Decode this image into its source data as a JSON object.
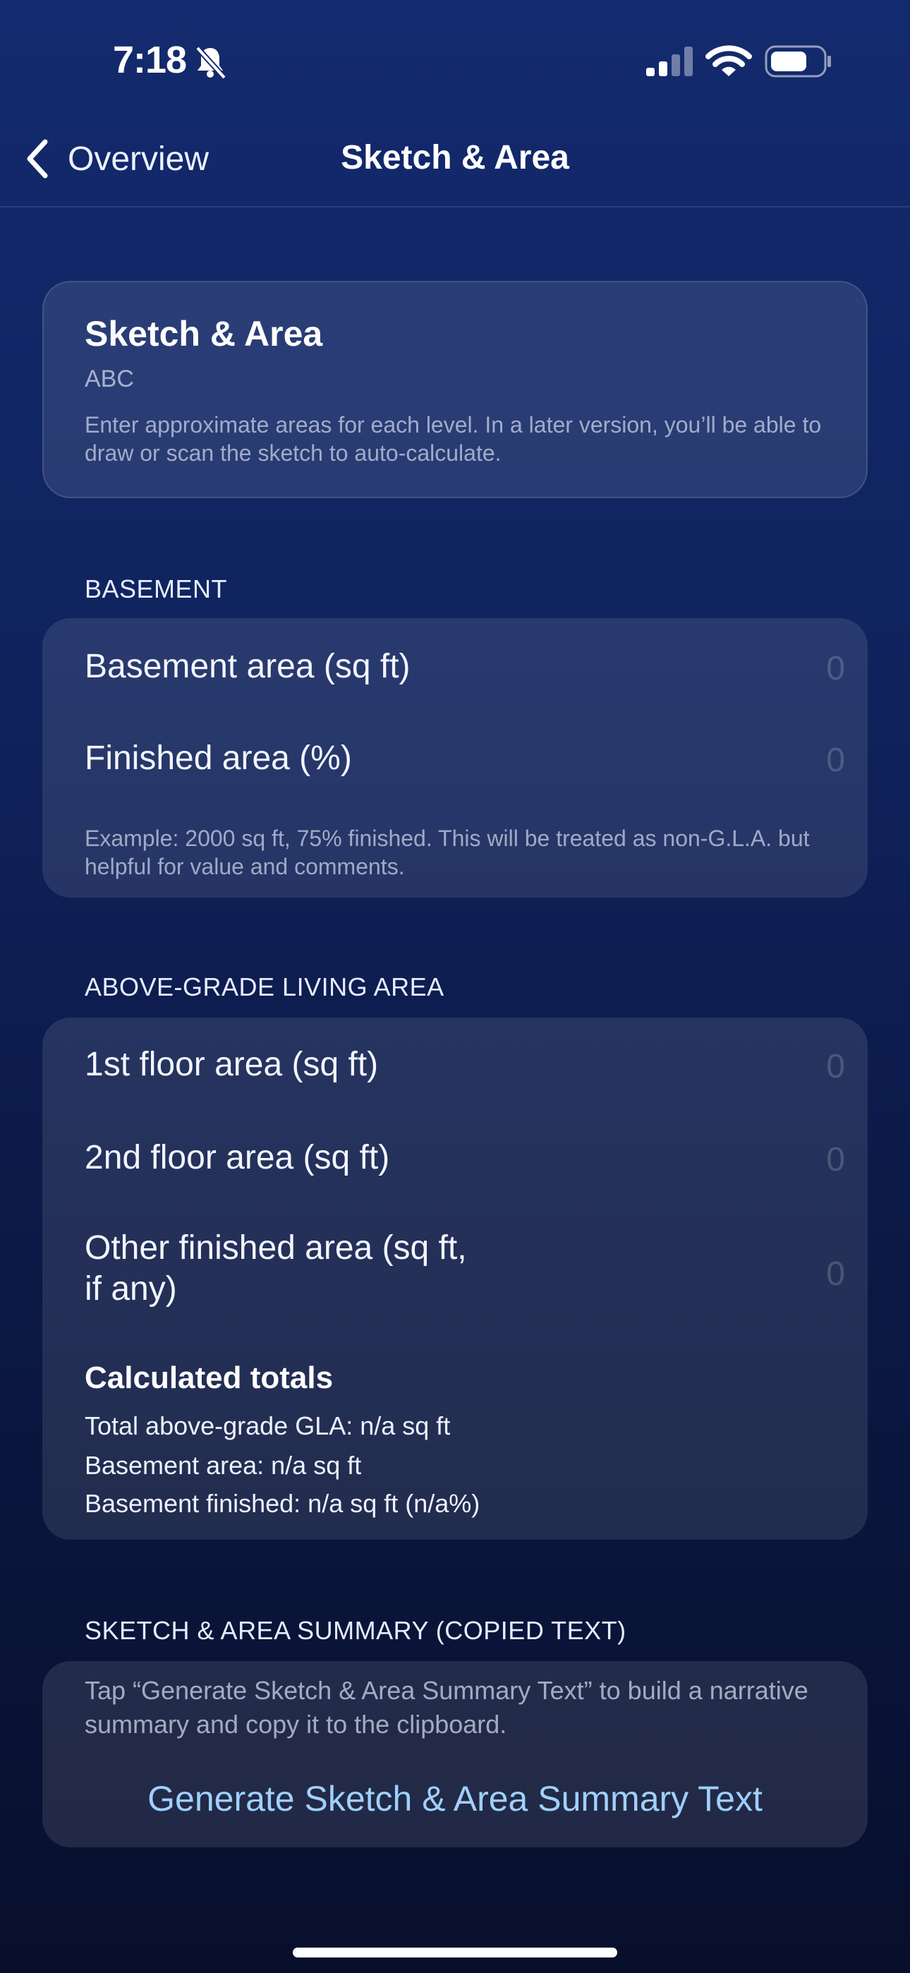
{
  "status_bar": {
    "time": "7:18",
    "icons": [
      "bell-slash-icon",
      "signal-icon",
      "wifi-icon",
      "battery-icon"
    ]
  },
  "nav": {
    "back_label": "Overview",
    "title": "Sketch & Area"
  },
  "intro": {
    "title": "Sketch & Area",
    "subtitle": "ABC",
    "description": "Enter approximate areas for each level. In a later version, you’ll be able to draw or scan the sketch to auto-calculate."
  },
  "basement": {
    "header": "BASEMENT",
    "area_label": "Basement area (sq ft)",
    "area_placeholder": "0",
    "finished_label": "Finished area (%)",
    "finished_placeholder": "0",
    "footnote": "Example: 2000 sq ft, 75% finished. This will be treated as non-G.L.A. but helpful for value and comments."
  },
  "above_grade": {
    "header": "ABOVE-GRADE LIVING AREA",
    "floor1_label": "1st floor area (sq ft)",
    "floor1_placeholder": "0",
    "floor2_label": "2nd floor area (sq ft)",
    "floor2_placeholder": "0",
    "other_label_line1": "Other finished area (sq ft,",
    "other_label_line2": "if any)",
    "other_placeholder": "0"
  },
  "totals": {
    "title": "Calculated totals",
    "gla": "Total above-grade GLA: n/a sq ft",
    "basement_area": "Basement area: n/a sq ft",
    "basement_finished": "Basement finished: n/a sq ft (n/a%)"
  },
  "summary": {
    "header": "SKETCH & AREA SUMMARY (COPIED TEXT)",
    "hint": "Tap “Generate Sketch & Area Summary Text” to build a narrative summary and copy it to the clipboard.",
    "button_label": "Generate Sketch & Area Summary Text"
  },
  "colors": {
    "accent": "#9fd0ff",
    "background_top": "#132a6e",
    "background_bottom": "#080f2c"
  }
}
